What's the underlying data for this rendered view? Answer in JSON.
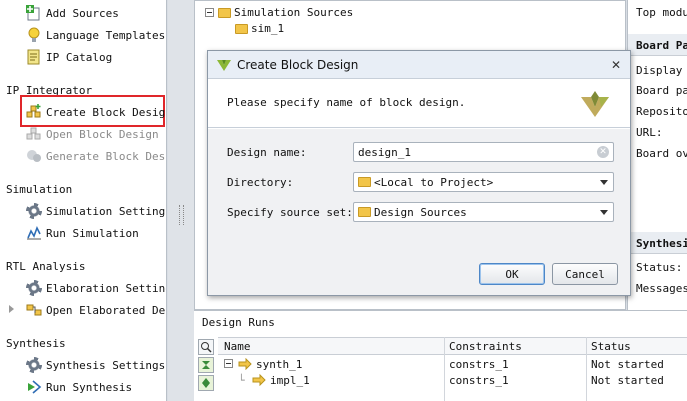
{
  "flow_navigator": {
    "top_items": [
      "Add Sources",
      "Language Templates",
      "IP Catalog"
    ],
    "ip_integrator": {
      "title": "IP Integrator",
      "items": [
        "Create Block Design",
        "Open Block Design",
        "Generate Block Design"
      ]
    },
    "simulation": {
      "title": "Simulation",
      "items": [
        "Simulation Settings",
        "Run Simulation"
      ]
    },
    "rtl_analysis": {
      "title": "RTL Analysis",
      "items": [
        "Elaboration Settings",
        "Open Elaborated Design"
      ]
    },
    "synthesis": {
      "title": "Synthesis",
      "items": [
        "Synthesis Settings",
        "Run Synthesis"
      ]
    }
  },
  "sources": {
    "tree": [
      "Simulation Sources",
      "sim_1"
    ]
  },
  "properties": {
    "top_text": "Top modul",
    "board_part_title": "Board Pa",
    "board_rows": [
      "Display n",
      "Board par",
      "Repositor",
      "URL:",
      "Board ove"
    ],
    "synthesis_title": "Synthesi",
    "synthesis_rows": [
      "Status:",
      "Messages:"
    ]
  },
  "dialog": {
    "title": "Create Block Design",
    "close_glyph": "✕",
    "message": "Please specify name of block design.",
    "design_name_label": "Design name:",
    "design_name_value": "design_1",
    "directory_label": "Directory:",
    "directory_value": "<Local to Project>",
    "source_set_label": "Specify source set:",
    "source_set_value": "Design Sources",
    "ok_label": "OK",
    "cancel_label": "Cancel"
  },
  "design_runs": {
    "title": "Design Runs",
    "columns": [
      "Name",
      "Constraints",
      "Status"
    ],
    "rows": [
      {
        "name": "synth_1",
        "constraints": "constrs_1",
        "status": "Not started"
      },
      {
        "name": "impl_1",
        "constraints": "constrs_1",
        "status": "Not started"
      }
    ]
  },
  "colors": {
    "highlight": "#e0262a",
    "accent": "#4d87c7"
  }
}
